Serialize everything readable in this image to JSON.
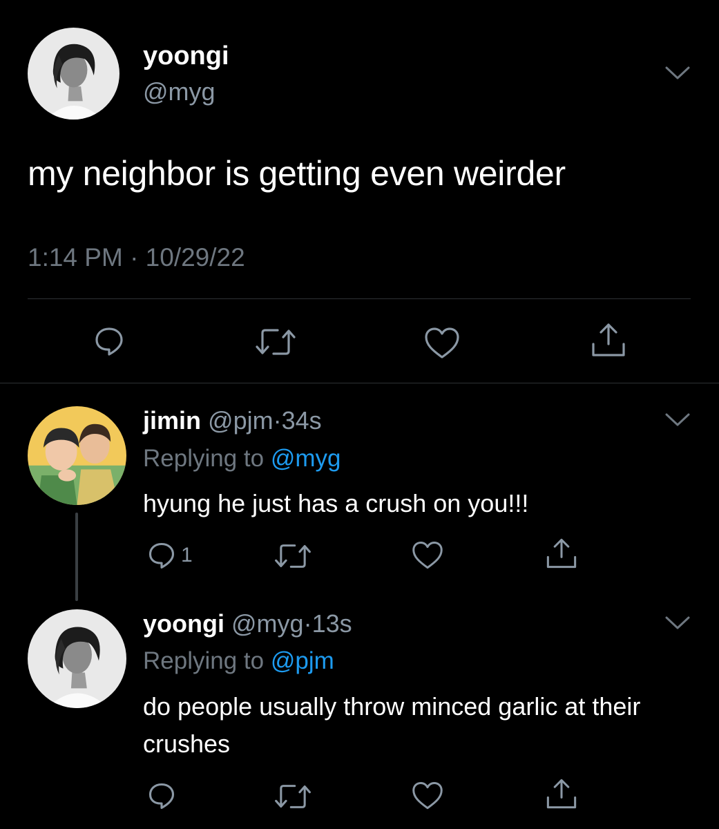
{
  "main_tweet": {
    "name": "yoongi",
    "handle": "@myg",
    "text": "my neighbor is getting even weirder",
    "timestamp": "1:14 PM · 10/29/22"
  },
  "replies": [
    {
      "name": "jimin",
      "handle": "@pjm",
      "separator": "·",
      "time": "34s",
      "replying_prefix": "Replying to ",
      "replying_to": "@myg",
      "text": "hyung he just has a crush on you!!!",
      "reply_count": "1"
    },
    {
      "name": "yoongi",
      "handle": "@myg",
      "separator": "·",
      "time": "13s",
      "replying_prefix": "Replying to ",
      "replying_to": "@pjm",
      "text": "do people usually throw minced garlic at their crushes",
      "reply_count": ""
    }
  ],
  "icons": {
    "reply": "reply-icon",
    "retweet": "retweet-icon",
    "like": "heart-icon",
    "share": "share-icon",
    "more": "chevron-down-icon"
  },
  "colors": {
    "background": "#000000",
    "text": "#ffffff",
    "secondary": "#8b98a5",
    "link": "#1d9bf0",
    "divider": "#2f3336"
  }
}
